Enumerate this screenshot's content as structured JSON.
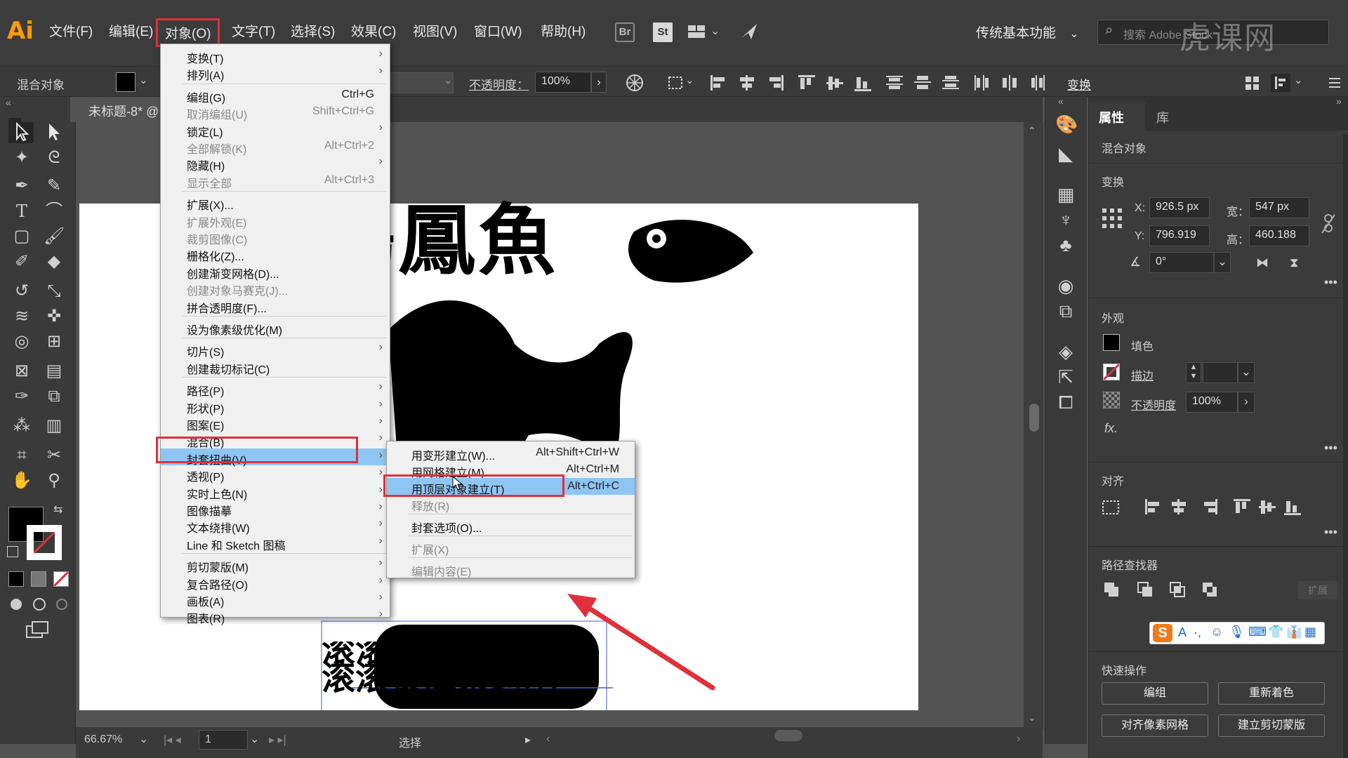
{
  "app": {
    "logo": "Ai",
    "menus": [
      "文件(F)",
      "编辑(E)",
      "对象(O)",
      "文字(T)",
      "选择(S)",
      "效果(C)",
      "视图(V)",
      "窗口(W)",
      "帮助(H)"
    ],
    "bridge_label": "Br",
    "stock_label": "St",
    "workspace": "传统基本功能",
    "search_placeholder": "搜索 Adobe Stock",
    "watermark": "虎课网"
  },
  "control_bar": {
    "selection_type": "混合对象",
    "opacity_label": "不透明度：",
    "opacity_value": "100%",
    "transform_label": "变换"
  },
  "document": {
    "tab_title": "未标题-8* @",
    "zoom": "66.67%",
    "artboard_number": "1",
    "status_tool": "选择"
  },
  "artwork": {
    "title_text": "鶴鳳魚",
    "slogan_line1": "滚滚長江東逝水",
    "slogan_line2": "滚滚長江東逝水"
  },
  "object_menu": {
    "items": [
      {
        "label": "变换(T)",
        "shortcut": "",
        "submenu": true,
        "disabled": false
      },
      {
        "label": "排列(A)",
        "shortcut": "",
        "submenu": true,
        "disabled": false
      },
      {
        "label": "编组(G)",
        "shortcut": "Ctrl+G",
        "submenu": false,
        "disabled": false
      },
      {
        "label": "取消编组(U)",
        "shortcut": "Shift+Ctrl+G",
        "submenu": false,
        "disabled": true
      },
      {
        "label": "锁定(L)",
        "shortcut": "",
        "submenu": true,
        "disabled": false
      },
      {
        "label": "全部解锁(K)",
        "shortcut": "Alt+Ctrl+2",
        "submenu": false,
        "disabled": true
      },
      {
        "label": "隐藏(H)",
        "shortcut": "",
        "submenu": true,
        "disabled": false
      },
      {
        "label": "显示全部",
        "shortcut": "Alt+Ctrl+3",
        "submenu": false,
        "disabled": true
      },
      {
        "label": "扩展(X)...",
        "shortcut": "",
        "submenu": false,
        "disabled": false
      },
      {
        "label": "扩展外观(E)",
        "shortcut": "",
        "submenu": false,
        "disabled": true
      },
      {
        "label": "裁剪图像(C)",
        "shortcut": "",
        "submenu": false,
        "disabled": true
      },
      {
        "label": "栅格化(Z)...",
        "shortcut": "",
        "submenu": false,
        "disabled": false
      },
      {
        "label": "创建渐变网格(D)...",
        "shortcut": "",
        "submenu": false,
        "disabled": false
      },
      {
        "label": "创建对象马赛克(J)...",
        "shortcut": "",
        "submenu": false,
        "disabled": true
      },
      {
        "label": "拼合透明度(F)...",
        "shortcut": "",
        "submenu": false,
        "disabled": false
      },
      {
        "label": "设为像素级优化(M)",
        "shortcut": "",
        "submenu": false,
        "disabled": false
      },
      {
        "label": "切片(S)",
        "shortcut": "",
        "submenu": true,
        "disabled": false
      },
      {
        "label": "创建裁切标记(C)",
        "shortcut": "",
        "submenu": false,
        "disabled": false
      },
      {
        "label": "路径(P)",
        "shortcut": "",
        "submenu": true,
        "disabled": false
      },
      {
        "label": "形状(P)",
        "shortcut": "",
        "submenu": true,
        "disabled": false
      },
      {
        "label": "图案(E)",
        "shortcut": "",
        "submenu": true,
        "disabled": false
      },
      {
        "label": "混合(B)",
        "shortcut": "",
        "submenu": true,
        "disabled": false
      },
      {
        "label": "封套扭曲(V)",
        "shortcut": "",
        "submenu": true,
        "disabled": false
      },
      {
        "label": "透视(P)",
        "shortcut": "",
        "submenu": true,
        "disabled": false
      },
      {
        "label": "实时上色(N)",
        "shortcut": "",
        "submenu": true,
        "disabled": false
      },
      {
        "label": "图像描摹",
        "shortcut": "",
        "submenu": true,
        "disabled": false
      },
      {
        "label": "文本绕排(W)",
        "shortcut": "",
        "submenu": true,
        "disabled": false
      },
      {
        "label": "Line 和 Sketch 图稿",
        "shortcut": "",
        "submenu": true,
        "disabled": false
      },
      {
        "label": "剪切蒙版(M)",
        "shortcut": "",
        "submenu": true,
        "disabled": false
      },
      {
        "label": "复合路径(O)",
        "shortcut": "",
        "submenu": true,
        "disabled": false
      },
      {
        "label": "画板(A)",
        "shortcut": "",
        "submenu": true,
        "disabled": false
      },
      {
        "label": "图表(R)",
        "shortcut": "",
        "submenu": true,
        "disabled": false
      }
    ]
  },
  "envelope_menu": {
    "items": [
      {
        "label": "用变形建立(W)...",
        "shortcut": "Alt+Shift+Ctrl+W",
        "disabled": false
      },
      {
        "label": "用网格建立(M)...",
        "shortcut": "Alt+Ctrl+M",
        "disabled": false
      },
      {
        "label": "用顶层对象建立(T)",
        "shortcut": "Alt+Ctrl+C",
        "disabled": false
      },
      {
        "label": "释放(R)",
        "shortcut": "",
        "disabled": true
      },
      {
        "label": "封套选项(O)...",
        "shortcut": "",
        "disabled": false
      },
      {
        "label": "扩展(X)",
        "shortcut": "",
        "disabled": true
      },
      {
        "label": "编辑内容(E)",
        "shortcut": "",
        "disabled": true
      }
    ]
  },
  "properties_panel": {
    "tabs": [
      "属性",
      "库"
    ],
    "object_type": "混合对象",
    "transform_title": "变换",
    "x_label": "X:",
    "x_value": "926.5 px",
    "y_label": "Y:",
    "y_value": "796.919",
    "w_label": "宽：",
    "w_value": "547 px",
    "h_label": "高：",
    "h_value": "460.188",
    "angle_value": "0°",
    "appearance_title": "外观",
    "fill_label": "填色",
    "stroke_label": "描边",
    "opacity_label": "不透明度",
    "opacity_value": "100%",
    "fx_label": "fx.",
    "align_title": "对齐",
    "pathfinder_title": "路径查找器",
    "expand_label": "扩展",
    "quick_actions_title": "快速操作",
    "btn_group": "编组",
    "btn_recolor": "重新着色",
    "btn_align_pixel": "对齐像素网格",
    "btn_clip_mask": "建立剪切蒙版"
  },
  "ime_bar": {
    "logo": "S",
    "mode": "A"
  },
  "colors": {
    "menu_highlight": "#8fc5f5",
    "annotation_red": "#e0303a",
    "ai_orange": "#ff9a00"
  }
}
